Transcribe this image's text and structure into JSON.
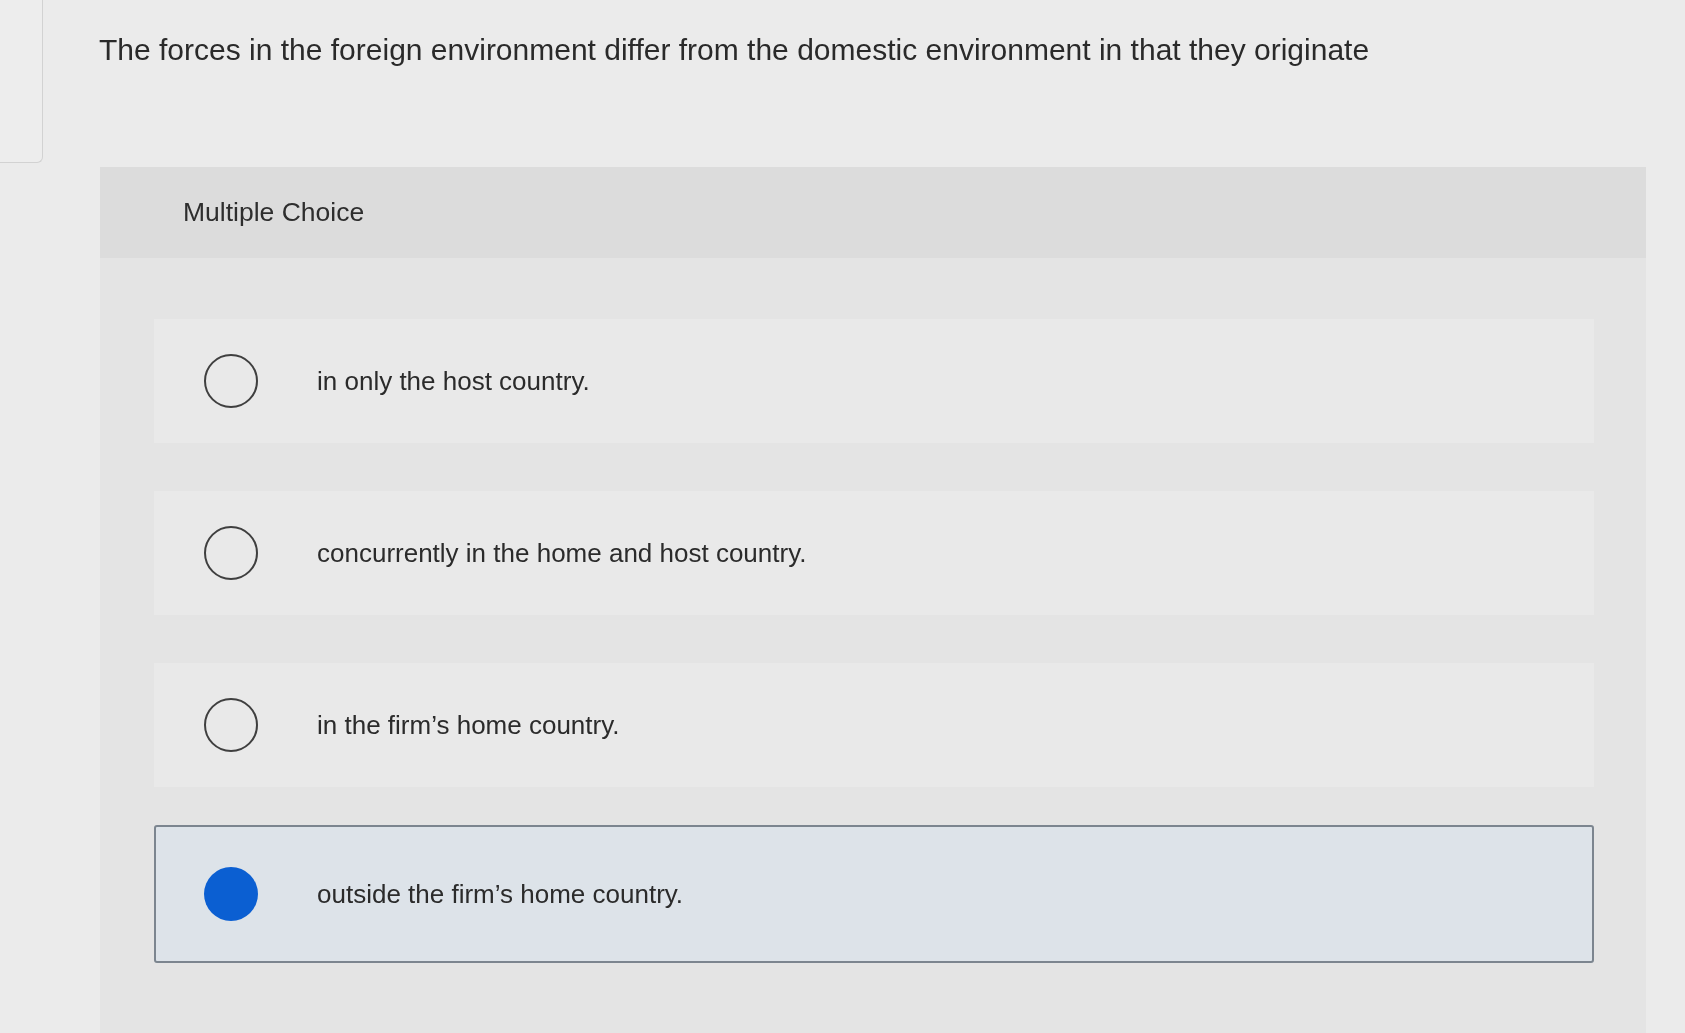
{
  "question": "The forces in the foreign environment differ from the domestic environment in that they originate",
  "section_label": "Multiple Choice",
  "options": [
    {
      "text": "in only the host country.",
      "selected": false
    },
    {
      "text": "concurrently in the home and host country.",
      "selected": false
    },
    {
      "text": "in the firm’s home country.",
      "selected": false
    },
    {
      "text": "outside the firm’s home country.",
      "selected": true
    }
  ]
}
